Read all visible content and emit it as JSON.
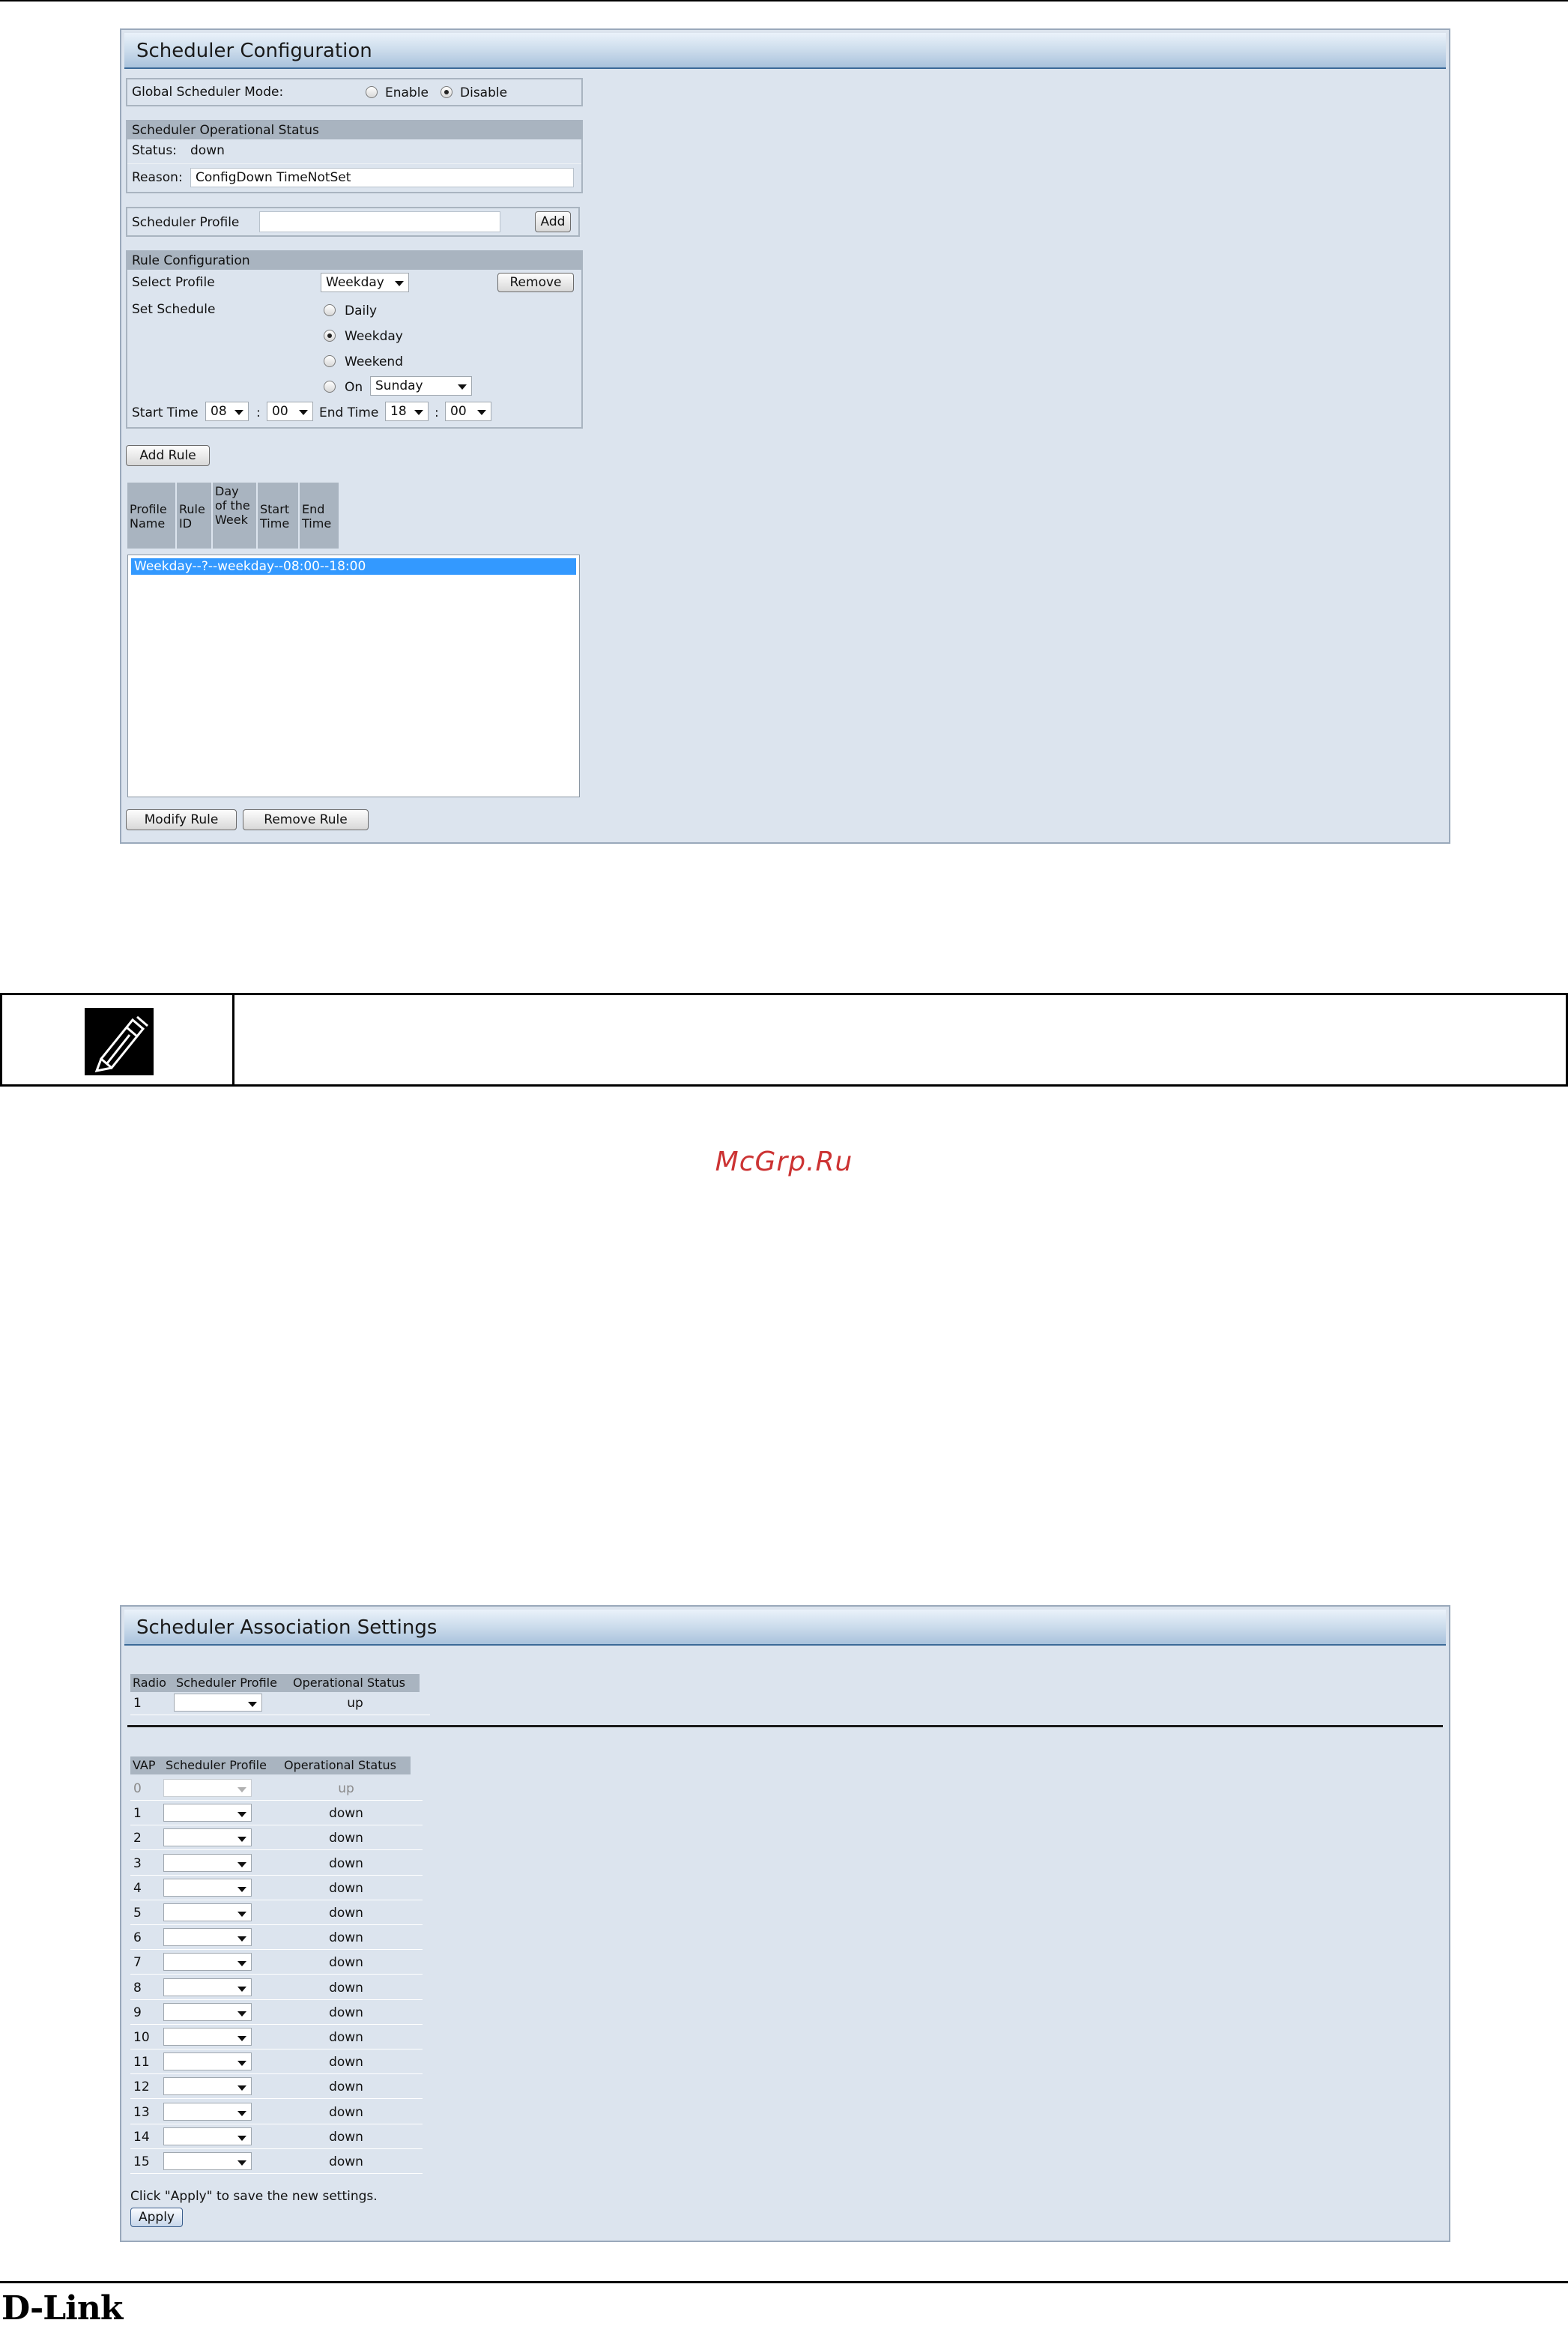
{
  "scheduler_config": {
    "title": "Scheduler Configuration",
    "global_mode_label": "Global Scheduler Mode:",
    "enable_label": "Enable",
    "disable_label": "Disable",
    "global_mode_selected": "Disable",
    "op_status_header": "Scheduler Operational Status",
    "status_label": "Status:",
    "status_value": "down",
    "reason_label": "Reason:",
    "reason_value": "ConfigDown  TimeNotSet",
    "profile_label": "Scheduler Profile",
    "profile_value": "",
    "add_button": "Add",
    "rule_config_header": "Rule Configuration",
    "select_profile_label": "Select Profile",
    "select_profile_value": "Weekday",
    "remove_button": "Remove",
    "set_schedule_label": "Set Schedule",
    "schedule_options": [
      "Daily",
      "Weekday",
      "Weekend",
      "On"
    ],
    "schedule_selected": "Weekday",
    "on_day_value": "Sunday",
    "start_time_label": "Start Time",
    "start_hour": "08",
    "start_min": "00",
    "end_time_label": "End Time",
    "end_hour": "18",
    "end_min": "00",
    "colon": ":",
    "add_rule_button": "Add Rule",
    "rule_table_headers": [
      "Profile Name",
      "Rule ID",
      "Day of the Week",
      "Start Time",
      "End Time"
    ],
    "rule_list": [
      "Weekday--?--weekday--08:00--18:00"
    ],
    "modify_rule_button": "Modify Rule",
    "remove_rule_button": "Remove Rule"
  },
  "watermark": "McGrp.Ru",
  "association": {
    "title": "Scheduler Association Settings",
    "radio_headers": [
      "Radio",
      "Scheduler Profile",
      "Operational Status"
    ],
    "radio_rows": [
      {
        "id": "1",
        "profile": "",
        "status": "up"
      }
    ],
    "vap_headers": [
      "VAP",
      "Scheduler Profile",
      "Operational Status"
    ],
    "vap_rows": [
      {
        "id": "0",
        "profile": "",
        "status": "up"
      },
      {
        "id": "1",
        "profile": "",
        "status": "down"
      },
      {
        "id": "2",
        "profile": "",
        "status": "down"
      },
      {
        "id": "3",
        "profile": "",
        "status": "down"
      },
      {
        "id": "4",
        "profile": "",
        "status": "down"
      },
      {
        "id": "5",
        "profile": "",
        "status": "down"
      },
      {
        "id": "6",
        "profile": "",
        "status": "down"
      },
      {
        "id": "7",
        "profile": "",
        "status": "down"
      },
      {
        "id": "8",
        "profile": "",
        "status": "down"
      },
      {
        "id": "9",
        "profile": "",
        "status": "down"
      },
      {
        "id": "10",
        "profile": "",
        "status": "down"
      },
      {
        "id": "11",
        "profile": "",
        "status": "down"
      },
      {
        "id": "12",
        "profile": "",
        "status": "down"
      },
      {
        "id": "13",
        "profile": "",
        "status": "down"
      },
      {
        "id": "14",
        "profile": "",
        "status": "down"
      },
      {
        "id": "15",
        "profile": "",
        "status": "down"
      }
    ],
    "apply_hint": "Click \"Apply\" to save the new settings.",
    "apply_button": "Apply"
  },
  "footer": {
    "logo": "D-Link"
  },
  "icons": {
    "note": "pencil-note-icon"
  }
}
